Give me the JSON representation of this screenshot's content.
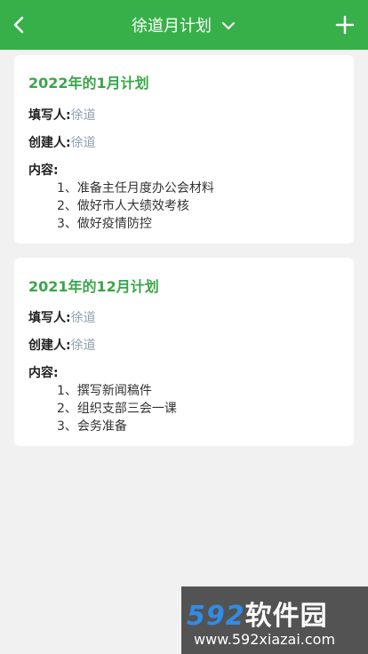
{
  "header": {
    "title": "徐道月计划",
    "back_icon": "back-arrow-icon",
    "dropdown_icon": "chevron-down-icon",
    "add_icon": "plus-icon"
  },
  "plans": [
    {
      "title": "2022年的1月计划",
      "filler_label": "填写人:",
      "filler_value": "徐道",
      "creator_label": "创建人:",
      "creator_value": "徐道",
      "content_label": "内容:",
      "items": [
        "1、准备主任月度办公会材料",
        "2、做好市人大绩效考核",
        "3、做好疫情防控"
      ]
    },
    {
      "title": "2021年的12月计划",
      "filler_label": "填写人:",
      "filler_value": "徐道",
      "creator_label": "创建人:",
      "creator_value": "徐道",
      "content_label": "内容:",
      "items": [
        "1、撰写新闻稿件",
        "2、组织支部三会一课",
        "3、会务准备"
      ]
    }
  ],
  "watermark": {
    "logo_num": "592",
    "logo_text": "软件园",
    "url": "www.592xiazai.com"
  },
  "colors": {
    "header_bg": "#38b04a",
    "title_green": "#3aa54a",
    "value_gray": "#8ea1b0"
  }
}
